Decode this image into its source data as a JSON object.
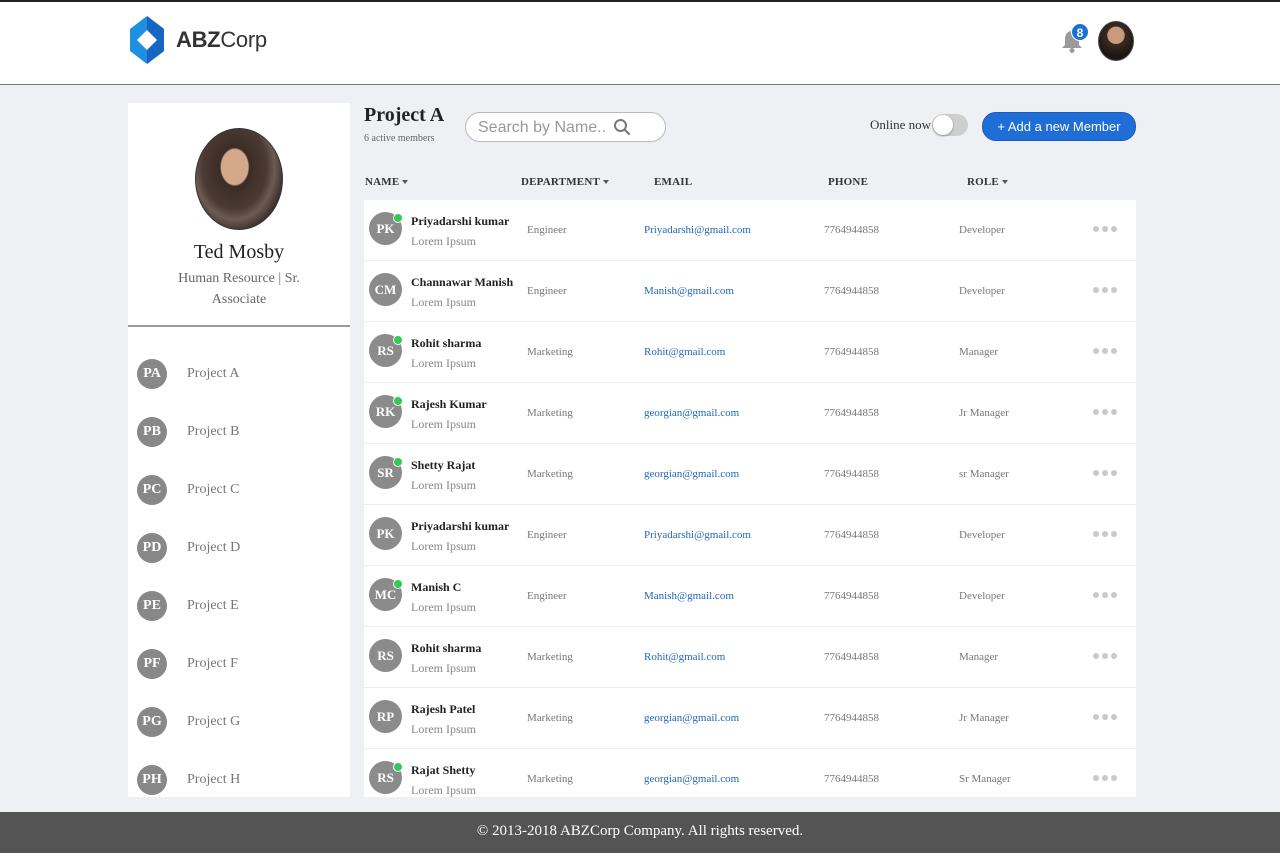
{
  "brand": {
    "name_bold": "ABZ",
    "name_light": "Corp",
    "accent": "#1f6ed7"
  },
  "header": {
    "notification_count": "8",
    "icons": [
      "bell-icon",
      "avatar"
    ]
  },
  "profile": {
    "name": "Ted Mosby",
    "role": "Human Resource | Sr. Associate"
  },
  "projects": [
    {
      "initials": "PA",
      "label": "Project A"
    },
    {
      "initials": "PB",
      "label": "Project B"
    },
    {
      "initials": "PC",
      "label": "Project C"
    },
    {
      "initials": "PD",
      "label": "Project D"
    },
    {
      "initials": "PE",
      "label": "Project E"
    },
    {
      "initials": "PF",
      "label": "Project F"
    },
    {
      "initials": "PG",
      "label": "Project G"
    },
    {
      "initials": "PH",
      "label": "Project H"
    }
  ],
  "main": {
    "title": "Project A",
    "subtitle": "6 active members",
    "search_placeholder": "Search by Name..",
    "online_label": "Online now",
    "online_toggle": false,
    "add_button": "+ Add a new Member",
    "columns": {
      "name": "NAME",
      "department": "DEPARTMENT",
      "email": "EMAIL",
      "phone": "PHONE",
      "role": "ROLE"
    },
    "members": [
      {
        "initials": "PK",
        "name": "Priyadarshi kumar",
        "sub": "Lorem Ipsum",
        "department": "Engineer",
        "email": "Priyadarshi@gmail.com",
        "phone": "7764944858",
        "role": "Developer",
        "online": true
      },
      {
        "initials": "CM",
        "name": "Channawar Manish",
        "sub": "Lorem Ipsum",
        "department": "Engineer",
        "email": "Manish@gmail.com",
        "phone": "7764944858",
        "role": "Developer",
        "online": false
      },
      {
        "initials": "RS",
        "name": "Rohit sharma",
        "sub": "Lorem Ipsum",
        "department": "Marketing",
        "email": "Rohit@gmail.com",
        "phone": "7764944858",
        "role": "Manager",
        "online": true
      },
      {
        "initials": "RK",
        "name": "Rajesh Kumar",
        "sub": "Lorem Ipsum",
        "department": "Marketing",
        "email": "georgian@gmail.com",
        "phone": "7764944858",
        "role": "Jr Manager",
        "online": true
      },
      {
        "initials": "SR",
        "name": "Shetty Rajat",
        "sub": "Lorem Ipsum",
        "department": "Marketing",
        "email": "georgian@gmail.com",
        "phone": "7764944858",
        "role": "sr Manager",
        "online": true
      },
      {
        "initials": "PK",
        "name": "Priyadarshi kumar",
        "sub": "Lorem Ipsum",
        "department": "Engineer",
        "email": "Priyadarshi@gmail.com",
        "phone": "7764944858",
        "role": "Developer",
        "online": false
      },
      {
        "initials": "MC",
        "name": "Manish C",
        "sub": "Lorem Ipsum",
        "department": "Engineer",
        "email": "Manish@gmail.com",
        "phone": "7764944858",
        "role": "Developer",
        "online": true
      },
      {
        "initials": "RS",
        "name": "Rohit sharma",
        "sub": "Lorem Ipsum",
        "department": "Marketing",
        "email": "Rohit@gmail.com",
        "phone": "7764944858",
        "role": "Manager",
        "online": false
      },
      {
        "initials": "RP",
        "name": "Rajesh Patel",
        "sub": "Lorem Ipsum",
        "department": "Marketing",
        "email": "georgian@gmail.com",
        "phone": "7764944858",
        "role": "Jr Manager",
        "online": false
      },
      {
        "initials": "RS",
        "name": "Rajat Shetty",
        "sub": "Lorem Ipsum",
        "department": "Marketing",
        "email": "georgian@gmail.com",
        "phone": "7764944858",
        "role": "Sr Manager",
        "online": true
      }
    ]
  },
  "footer": {
    "text": "© 2013-2018 ABZCorp Company. All rights reserved."
  }
}
